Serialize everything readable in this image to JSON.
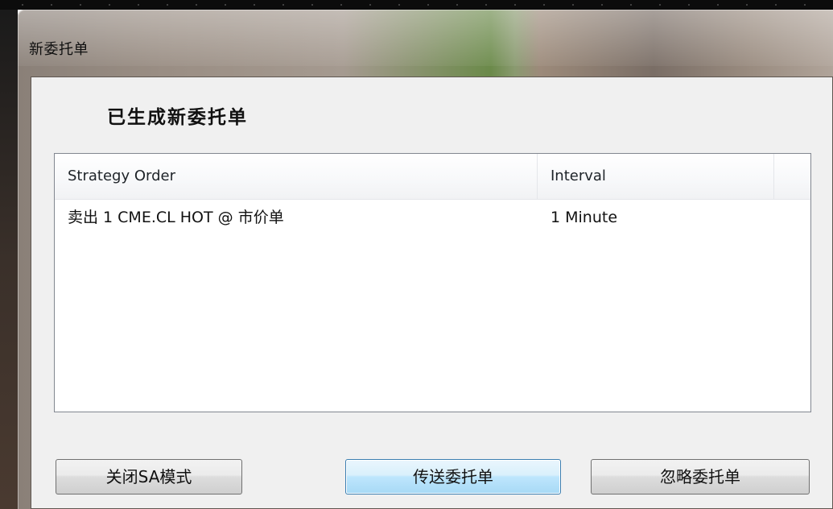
{
  "window": {
    "title": "新委托单"
  },
  "dialog": {
    "heading": "已生成新委托单"
  },
  "list": {
    "columns": [
      "Strategy Order",
      "Interval"
    ],
    "rows": [
      {
        "order": "卖出 1 CME.CL HOT @ 市价单",
        "interval": "1 Minute"
      }
    ]
  },
  "buttons": {
    "close_sa": "关闭SA模式",
    "send_order": "传送委托单",
    "ignore_order": "忽略委托单"
  },
  "colors": {
    "default_button_border": "#3c7fb1",
    "dialog_background": "#f0f0f0",
    "chart_up_candle": "#19c319",
    "chart_down_candle": "#e01818"
  }
}
